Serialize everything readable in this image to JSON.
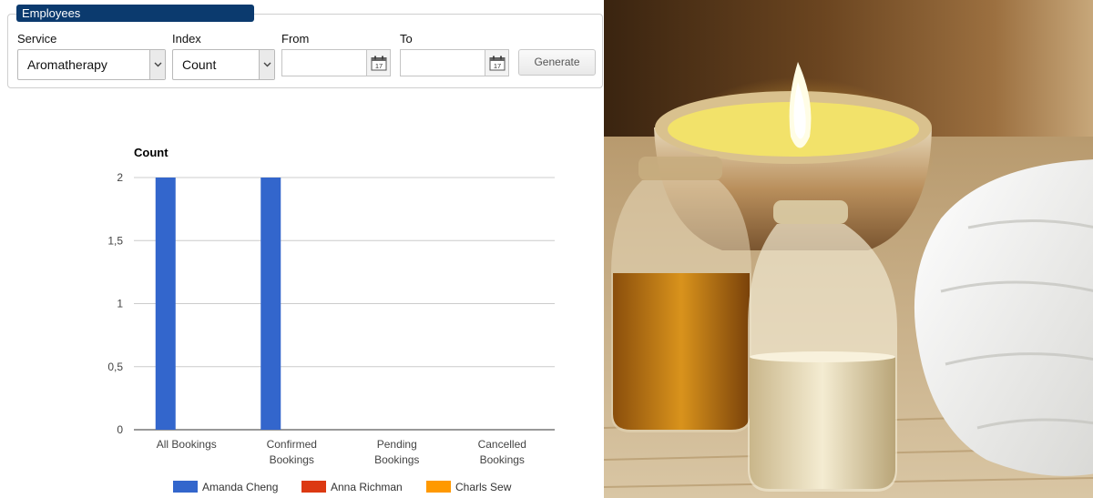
{
  "panel": {
    "legend": "Employees"
  },
  "filters": {
    "service": {
      "label": "Service",
      "value": "Aromatherapy"
    },
    "index": {
      "label": "Index",
      "value": "Count"
    },
    "from": {
      "label": "From",
      "value": ""
    },
    "to": {
      "label": "To",
      "value": ""
    },
    "calendar_day": "17",
    "generate_label": "Generate"
  },
  "chart_data": {
    "type": "bar",
    "title": "Count",
    "categories": [
      [
        "All Bookings"
      ],
      [
        "Confirmed",
        "Bookings"
      ],
      [
        "Pending",
        "Bookings"
      ],
      [
        "Cancelled",
        "Bookings"
      ]
    ],
    "yticks": [
      "0",
      "0,5",
      "1",
      "1,5",
      "2"
    ],
    "ylim": [
      0,
      2
    ],
    "series": [
      {
        "name": "Amanda Cheng",
        "color": "#3366cc",
        "values": [
          2,
          2,
          0,
          0
        ]
      },
      {
        "name": "Anna Richman",
        "color": "#dc3912",
        "values": [
          0,
          0,
          0,
          0
        ]
      },
      {
        "name": "Charls Sew",
        "color": "#ff9900",
        "values": [
          0,
          0,
          0,
          0
        ]
      }
    ],
    "grid": true,
    "legend": "bottom"
  },
  "photo": {
    "subject": "aromatherapy-oils-candle-towel"
  }
}
